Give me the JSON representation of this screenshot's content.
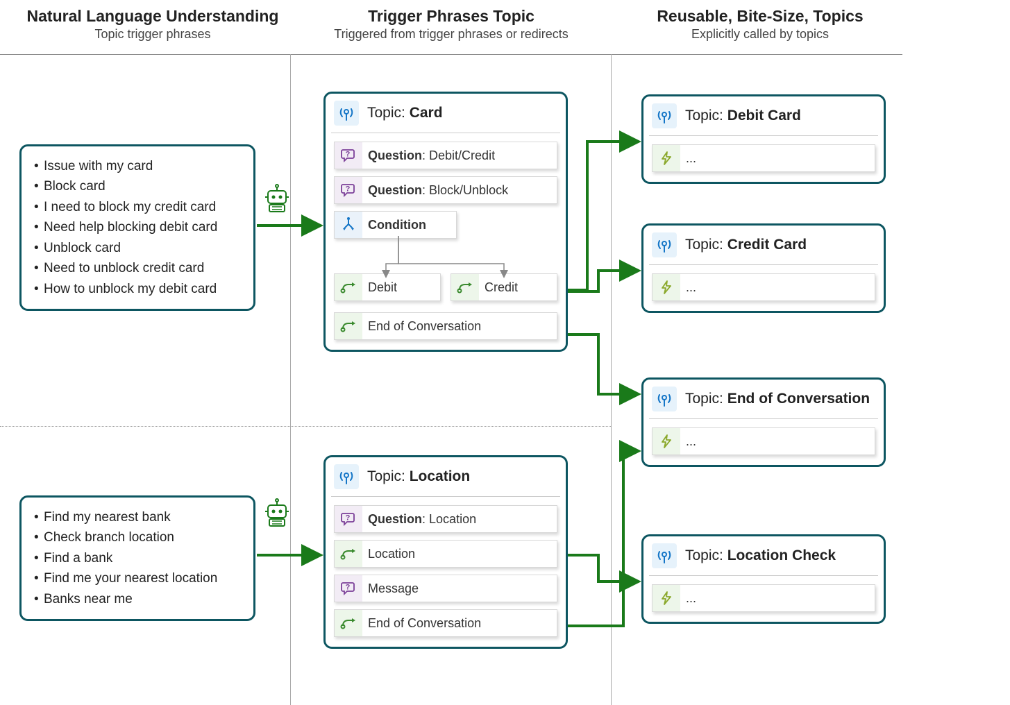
{
  "columns": {
    "nlu": {
      "title": "Natural Language Understanding",
      "subtitle": "Topic trigger phrases"
    },
    "trigger": {
      "title": "Trigger Phrases Topic",
      "subtitle": "Triggered from trigger phrases or redirects"
    },
    "reusable": {
      "title": "Reusable, Bite-Size, Topics",
      "subtitle": "Explicitly called by topics"
    }
  },
  "phrase_boxes": {
    "card": [
      "Issue with my card",
      "Block card",
      "I need to block my credit card",
      "Need help blocking debit card",
      "Unblock card",
      "Need to unblock credit card",
      "How to unblock my debit card"
    ],
    "location": [
      "Find my nearest bank",
      "Check branch location",
      "Find a bank",
      "Find me your nearest location",
      "Banks near me"
    ]
  },
  "topics": {
    "card": {
      "title_prefix": "Topic",
      "title": "Card",
      "q1_label": "Question",
      "q1_value": "Debit/Credit",
      "q2_label": "Question",
      "q2_value": "Block/Unblock",
      "condition": "Condition",
      "debit": "Debit",
      "credit": "Credit",
      "eoc": "End of Conversation"
    },
    "location": {
      "title_prefix": "Topic",
      "title": "Location",
      "q_label": "Question",
      "q_value": "Location",
      "loc": "Location",
      "msg": "Message",
      "eoc": "End of Conversation"
    }
  },
  "reusable": {
    "debit": {
      "title_prefix": "Topic",
      "title": "Debit Card",
      "content": "..."
    },
    "credit": {
      "title_prefix": "Topic",
      "title": "Credit Card",
      "content": "..."
    },
    "eoc": {
      "title_prefix": "Topic",
      "title": "End of Conversation",
      "content": "..."
    },
    "locchk": {
      "title_prefix": "Topic",
      "title": "Location Check",
      "content": "..."
    }
  },
  "icons": {
    "topic": "topic-icon",
    "question": "question-icon",
    "condition": "condition-icon",
    "redirect": "redirect-icon",
    "action": "action-icon",
    "robot": "robot-icon"
  }
}
